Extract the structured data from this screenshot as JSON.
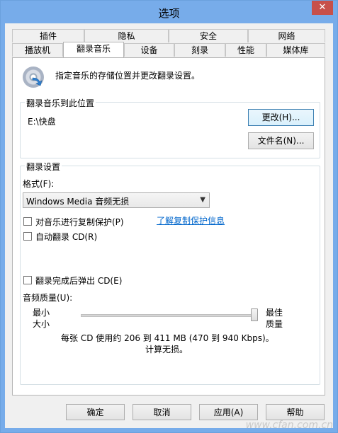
{
  "window": {
    "title": "选项",
    "close_glyph": "✕"
  },
  "tabs": {
    "row1": [
      "插件",
      "隐私",
      "安全",
      "网络"
    ],
    "row2": [
      "播放机",
      "翻录音乐",
      "设备",
      "刻录",
      "性能",
      "媒体库"
    ],
    "active": "翻录音乐"
  },
  "description": "指定音乐的存储位置并更改翻录设置。",
  "location_group": {
    "label": "翻录音乐到此位置",
    "path": "E:\\快盘",
    "change_button": "更改(H)...",
    "filename_button": "文件名(N)..."
  },
  "settings_group": {
    "label": "翻录设置",
    "format_label": "格式(F):",
    "format_value": "Windows Media 音频无损",
    "copy_protect_label": "对音乐进行复制保护(P)",
    "copy_protect_checked": false,
    "copy_protect_link": "了解复制保护信息",
    "auto_rip_label": "自动翻录 CD(R)",
    "auto_rip_checked": false,
    "eject_label": "翻录完成后弹出 CD(E)",
    "eject_checked": false,
    "quality_label": "音频质量(U):",
    "min_label_1": "最小",
    "min_label_2": "大小",
    "max_label_1": "最佳",
    "max_label_2": "质量",
    "quality_level": 1.0,
    "quality_info_1": "每张 CD 使用约 206 到 411 MB (470 到 940 Kbps)。",
    "quality_info_2": "计算无损。"
  },
  "footer": {
    "ok": "确定",
    "cancel": "取消",
    "apply": "应用(A)",
    "help": "帮助"
  },
  "watermark": "www.cfan.com.cn"
}
